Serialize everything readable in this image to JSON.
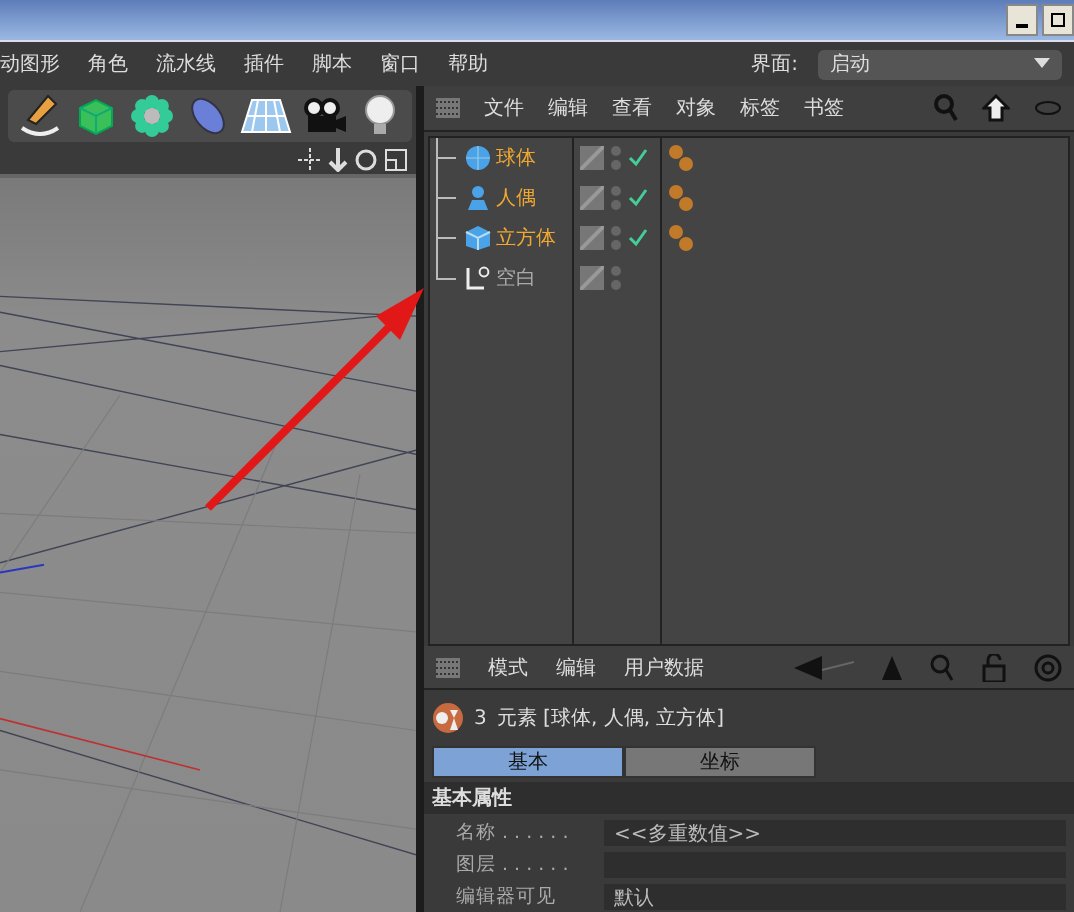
{
  "menu": [
    "动图形",
    "角色",
    "流水线",
    "插件",
    "脚本",
    "窗口",
    "帮助"
  ],
  "layout": {
    "label": "界面:",
    "value": "启动"
  },
  "object_manager": {
    "menu": [
      "文件",
      "编辑",
      "查看",
      "对象",
      "标签",
      "书签"
    ],
    "objects": [
      {
        "name": "球体",
        "kind": "sphere",
        "selected": true,
        "checked": true,
        "tagged": true
      },
      {
        "name": "人偶",
        "kind": "figure",
        "selected": true,
        "checked": true,
        "tagged": true
      },
      {
        "name": "立方体",
        "kind": "cube",
        "selected": true,
        "checked": true,
        "tagged": true
      },
      {
        "name": "空白",
        "kind": "null",
        "selected": false,
        "checked": false,
        "tagged": false
      }
    ]
  },
  "attributes": {
    "menu": [
      "模式",
      "编辑",
      "用户数据"
    ],
    "count": "3",
    "summary": "元素 [球体, 人偶, 立方体]",
    "tabs": [
      {
        "label": "基本",
        "selected": true
      },
      {
        "label": "坐标",
        "selected": false
      }
    ],
    "section": "基本属性",
    "fields": [
      {
        "label": "名称 . . . . . .",
        "value": "<<多重数值>>"
      },
      {
        "label": "图层 . . . . . ."
      },
      {
        "label": "编辑器可见",
        "value": "默认"
      }
    ]
  }
}
